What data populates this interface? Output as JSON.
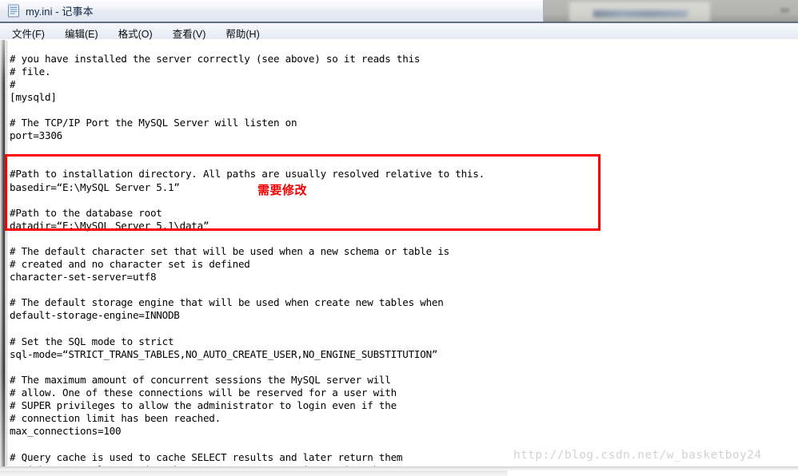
{
  "window": {
    "title": "my.ini - 记事本",
    "icon": "notepad-icon"
  },
  "menubar": {
    "items": [
      {
        "label": "文件(F)",
        "name": "menu-file"
      },
      {
        "label": "编辑(E)",
        "name": "menu-edit"
      },
      {
        "label": "格式(O)",
        "name": "menu-format"
      },
      {
        "label": "查看(V)",
        "name": "menu-view"
      },
      {
        "label": "帮助(H)",
        "name": "menu-help"
      }
    ]
  },
  "editor": {
    "content_before_box": "# you have installed the server correctly (see above) so it reads this\n# file.\n#\n[mysqld]\n\n# The TCP/IP Port the MySQL Server will listen on\nport=3306\n",
    "content": "# you have installed the server correctly (see above) so it reads this\n# file.\n#\n[mysqld]\n\n# The TCP/IP Port the MySQL Server will listen on\nport=3306\n\n\n#Path to installation directory. All paths are usually resolved relative to this.\nbasedir=“E:\\MySQL Server 5.1”\n\n#Path to the database root\ndatadir=“E:\\MySQL Server 5.1\\data”\n\n# The default character set that will be used when a new schema or table is\n# created and no character set is defined\ncharacter-set-server=utf8\n\n# The default storage engine that will be used when create new tables when\ndefault-storage-engine=INNODB\n\n# Set the SQL mode to strict\nsql-mode=“STRICT_TRANS_TABLES,NO_AUTO_CREATE_USER,NO_ENGINE_SUBSTITUTION”\n\n# The maximum amount of concurrent sessions the MySQL server will\n# allow. One of these connections will be reserved for a user with\n# SUPER privileges to allow the administrator to login even if the\n# connection limit has been reached.\nmax_connections=100\n\n# Query cache is used to cache SELECT results and later return them\n# without actual executing the same query once again. Having the query",
    "lines": [
      "# you have installed the server correctly (see above) so it reads this",
      "# file.",
      "#",
      "[mysqld]",
      "",
      "# The TCP/IP Port the MySQL Server will listen on",
      "port=3306",
      "",
      "",
      "#Path to installation directory. All paths are usually resolved relative to this.",
      "basedir=“E:\\MySQL Server 5.1”",
      "",
      "#Path to the database root",
      "datadir=“E:\\MySQL Server 5.1\\data”",
      "",
      "# The default character set that will be used when a new schema or table is",
      "# created and no character set is defined",
      "character-set-server=utf8",
      "",
      "# The default storage engine that will be used when create new tables when",
      "default-storage-engine=INNODB",
      "",
      "# Set the SQL mode to strict",
      "sql-mode=“STRICT_TRANS_TABLES,NO_AUTO_CREATE_USER,NO_ENGINE_SUBSTITUTION”",
      "",
      "# The maximum amount of concurrent sessions the MySQL server will",
      "# allow. One of these connections will be reserved for a user with",
      "# SUPER privileges to allow the administrator to login even if the",
      "# connection limit has been reached.",
      "max_connections=100",
      "",
      "# Query cache is used to cache SELECT results and later return them",
      "# without actual executing the same query once again. Having the query"
    ]
  },
  "annotation": {
    "red_note": "需要修改",
    "red_color": "#fe0000",
    "boxed_lines": [
      "#Path to installation directory. All paths are usually resolved relative to this.",
      "basedir=“E:\\MySQL Server 5.1”",
      "#Path to the database root",
      "datadir=“E:\\MySQL Server 5.1\\data”"
    ]
  },
  "watermark": {
    "text": "http://blog.csdn.net/w_basketboy24"
  }
}
